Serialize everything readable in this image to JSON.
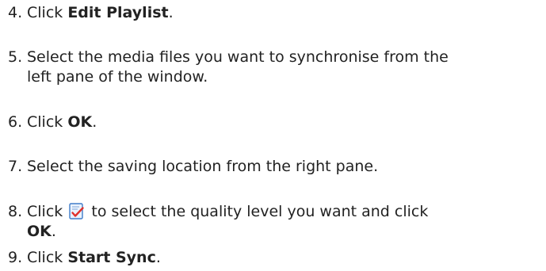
{
  "steps": [
    {
      "number": "4.",
      "before": "Click ",
      "bold": "Edit Playlist",
      "after": "."
    },
    {
      "number": "5.",
      "line1": "Select the media files you want to synchronise from the",
      "line2": "left pane of the window."
    },
    {
      "number": "6.",
      "before": "Click ",
      "bold": "OK",
      "after": "."
    },
    {
      "number": "7.",
      "text": "Select the saving location from the right pane."
    },
    {
      "number": "8.",
      "before": "Click ",
      "icon": "quality-settings-icon",
      "middle": " to select the quality level you want and click",
      "bold": "OK",
      "after": "."
    },
    {
      "number": "9.",
      "before": "Click ",
      "bold": "Start Sync",
      "after": "."
    }
  ],
  "colors": {
    "text": "#222222",
    "icon_blue": "#3f7cc9",
    "icon_check": "#e0302a"
  }
}
